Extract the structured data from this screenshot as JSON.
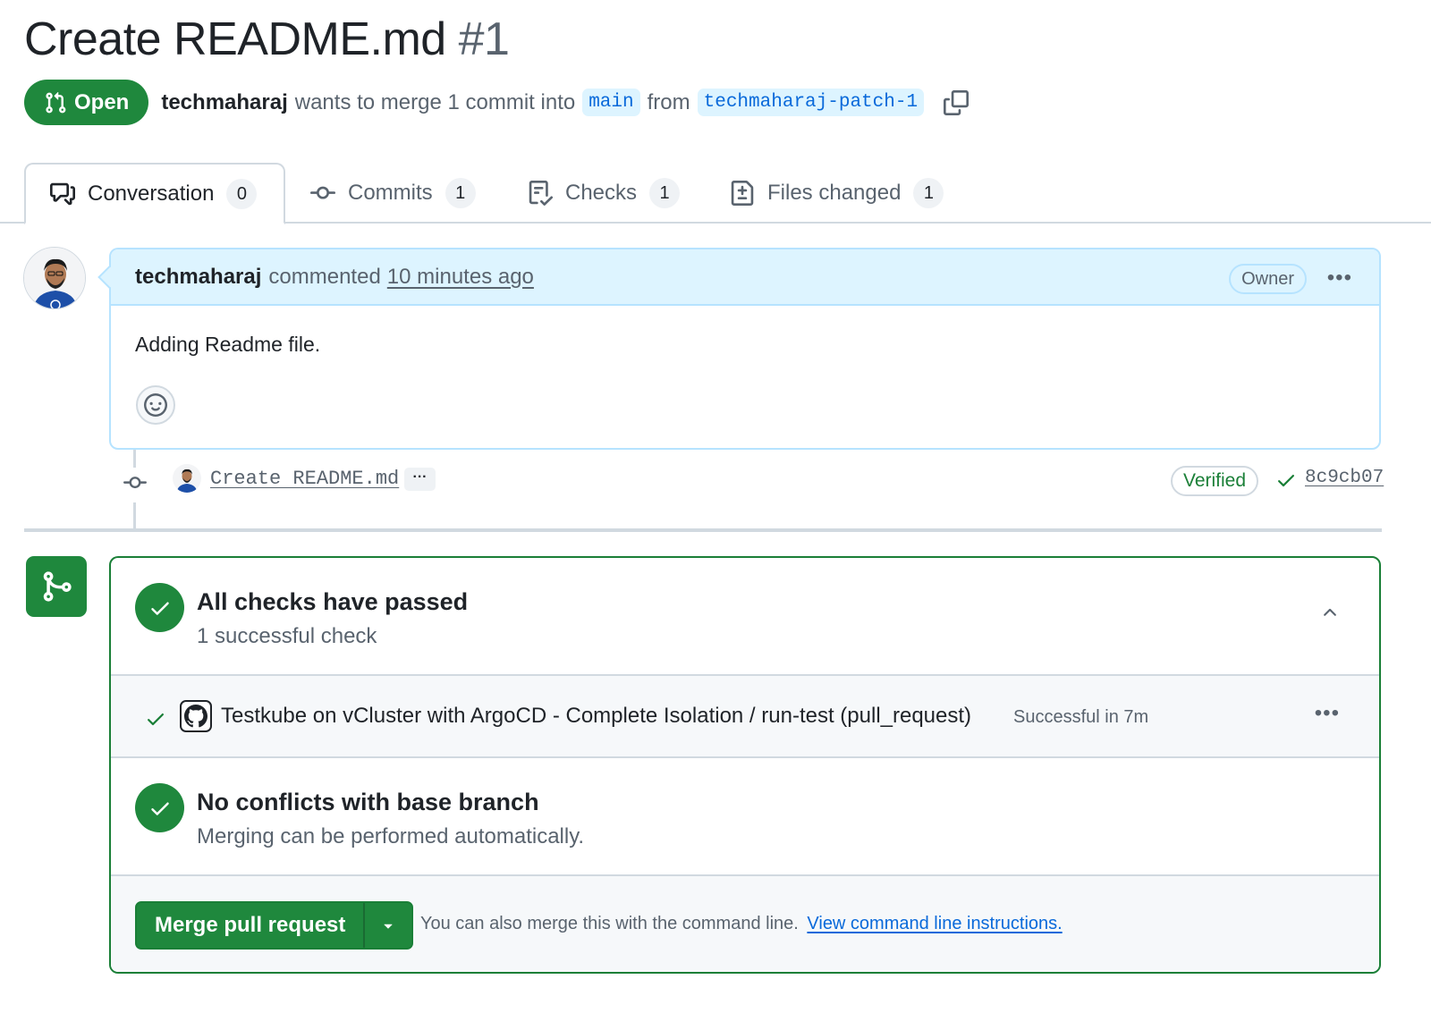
{
  "header": {
    "title": "Create README.md",
    "number": "#1",
    "state": "Open",
    "author": "techmaharaj",
    "merge_text": "wants to merge 1 commit into",
    "base_branch": "main",
    "from_text": "from",
    "head_branch": "techmaharaj-patch-1"
  },
  "tabs": [
    {
      "label": "Conversation",
      "count": "0",
      "icon": "comment-discussion-icon"
    },
    {
      "label": "Commits",
      "count": "1",
      "icon": "git-commit-icon"
    },
    {
      "label": "Checks",
      "count": "1",
      "icon": "checklist-icon"
    },
    {
      "label": "Files changed",
      "count": "1",
      "icon": "file-diff-icon"
    }
  ],
  "comment": {
    "author": "techmaharaj",
    "action": "commented",
    "time": "10 minutes ago",
    "badge": "Owner",
    "body": "Adding Readme file."
  },
  "commit": {
    "message": "Create README.md",
    "more": "···",
    "verified": "Verified",
    "sha": "8c9cb07"
  },
  "merge_box": {
    "checks_title": "All checks have passed",
    "checks_sub": "1 successful check",
    "check_item": {
      "name": "Testkube on vCluster with ArgoCD - Complete Isolation / run-test (pull_request)",
      "status": "Successful in 7m"
    },
    "conflicts_title": "No conflicts with base branch",
    "conflicts_sub": "Merging can be performed automatically.",
    "merge_button": "Merge pull request",
    "help_text": "You can also merge this with the command line.",
    "help_link": "View command line instructions."
  },
  "colors": {
    "success": "#1f883d",
    "accent": "#0969da",
    "muted": "#59636e",
    "branch_bg": "#ddf4ff"
  }
}
